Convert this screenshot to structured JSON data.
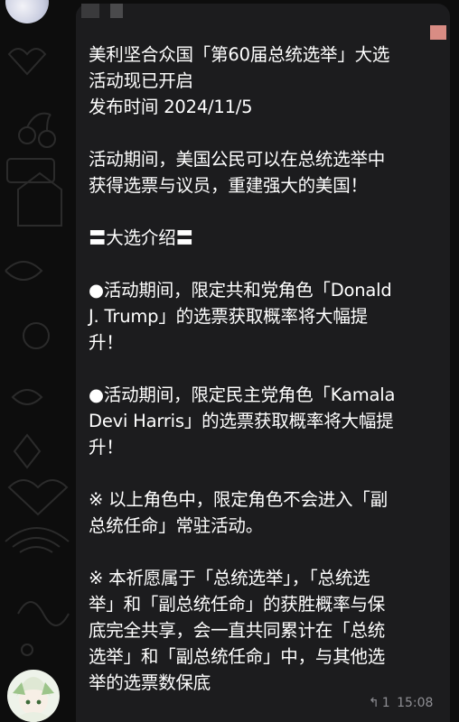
{
  "message": {
    "paragraphs": [
      "美利坚合众国「第60届总统选举」大选\n活动现已开启\n发布时间 2024/11/5",
      "活动期间，美国公民可以在总统选举中\n获得选票与议员，重建强大的美国！",
      "〓大选介绍〓",
      "●活动期间，限定共和党角色「Donald\nJ. Trump」的选票获取概率将大幅提\n升！",
      "●活动期间，限定民主党角色「Kamala\nDevi Harris」的选票获取概率将大幅提\n升！",
      "※ 以上角色中，限定角色不会进入「副\n总统任命」常驻活动。",
      "※ 本祈愿属于「总统选举」，「总统选\n举」和「副总统任命」的获胜概率与保\n底完全共享，会一直共同累计在「总统\n选举」和「副总统任命」中，与其他选\n举的选票数保底"
    ],
    "reply_count": "1",
    "time": "15:08"
  },
  "icons": {
    "reply": "reply-arrow-icon"
  },
  "colors": {
    "background": "#0d0d0d",
    "bubble": "#1c1c1e",
    "text": "#ffffff",
    "meta": "#8e8e93",
    "doodle": "#2a2a2a"
  }
}
